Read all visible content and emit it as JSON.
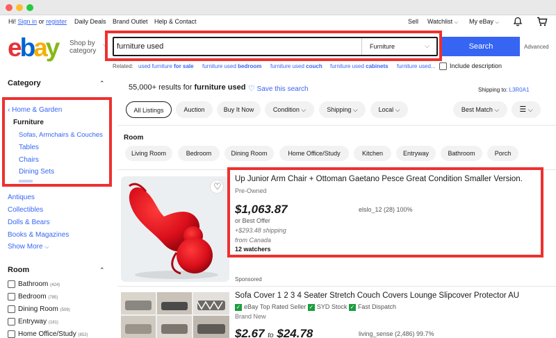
{
  "header": {
    "greeting_prefix": "Hi!",
    "sign_in": "Sign in",
    "or": "or",
    "register": "register",
    "links": [
      "Daily Deals",
      "Brand Outlet",
      "Help & Contact"
    ],
    "right_links": [
      "Sell",
      "Watchlist",
      "My eBay"
    ]
  },
  "search": {
    "shop_by_1": "Shop by",
    "shop_by_2": "category",
    "query": "furniture used",
    "category": "Furniture",
    "button": "Search",
    "advanced": "Advanced",
    "include_description": "Include description"
  },
  "related": {
    "label": "Related:",
    "items": [
      {
        "pre": "used furniture ",
        "bold": "for sale"
      },
      {
        "pre": "furniture used ",
        "bold": "bedroom"
      },
      {
        "pre": "furniture used ",
        "bold": "couch"
      },
      {
        "pre": "furniture used ",
        "bold": "cabinets"
      },
      {
        "pre": "furniture used...",
        "bold": ""
      }
    ]
  },
  "sidebar": {
    "category_heading": "Category",
    "home_garden": "‹ Home & Garden",
    "furniture": "Furniture",
    "sub": [
      "Sofas, Armchairs & Couches",
      "Tables",
      "Chairs",
      "Dining Sets"
    ],
    "other": [
      "Antiques",
      "Collectibles",
      "Dolls & Bears",
      "Books & Magazines"
    ],
    "show_more": "Show More",
    "room_heading": "Room",
    "rooms": [
      {
        "label": "Bathroom",
        "count": "(424)"
      },
      {
        "label": "Bedroom",
        "count": "(785)"
      },
      {
        "label": "Dining Room",
        "count": "(509)"
      },
      {
        "label": "Entryway",
        "count": "(181)"
      },
      {
        "label": "Home Office/Study",
        "count": "(852)"
      }
    ]
  },
  "results": {
    "count": "55,000+",
    "middle": " results for ",
    "query": "furniture used",
    "save": "Save this search",
    "ship_to_label": "Shipping to:",
    "ship_to_code": "L3R0A1"
  },
  "filters": [
    "All Listings",
    "Auction",
    "Buy It Now",
    "Condition",
    "Shipping",
    "Local"
  ],
  "sort": "Best Match",
  "room_filter": {
    "heading": "Room",
    "pills": [
      "Living Room",
      "Bedroom",
      "Dining Room",
      "Home Office/Study",
      "Kitchen",
      "Entryway",
      "Bathroom",
      "Porch"
    ]
  },
  "listings": [
    {
      "title": "Up Junior Arm Chair + Ottoman Gaetano Pesce Great Condition Smaller Version.",
      "condition": "Pre-Owned",
      "price": "$1,063.87",
      "best_offer": "or Best Offer",
      "shipping": "+$293.48 shipping",
      "from": "from Canada",
      "watchers": "12 watchers",
      "seller": "elslo_12 (28) 100%"
    },
    {
      "sponsored": "Sponsored",
      "title": "Sofa Cover 1 2 3 4 Seater Stretch Couch Covers Lounge Slipcover Protector AU",
      "badges": [
        "eBay Top Rated Seller",
        "SYD Stock",
        "Fast Dispatch"
      ],
      "condition": "Brand New",
      "price_from": "$2.67",
      "price_to_word": "to",
      "price_to": "$24.78",
      "seller": "living_sense (2,486) 99.7%"
    }
  ],
  "colors": {
    "accent": "#3665f3",
    "highlight": "#ee3030",
    "logo_e": "#e53238",
    "logo_b": "#0064d2",
    "logo_a": "#f5af02",
    "logo_y": "#86b817"
  }
}
